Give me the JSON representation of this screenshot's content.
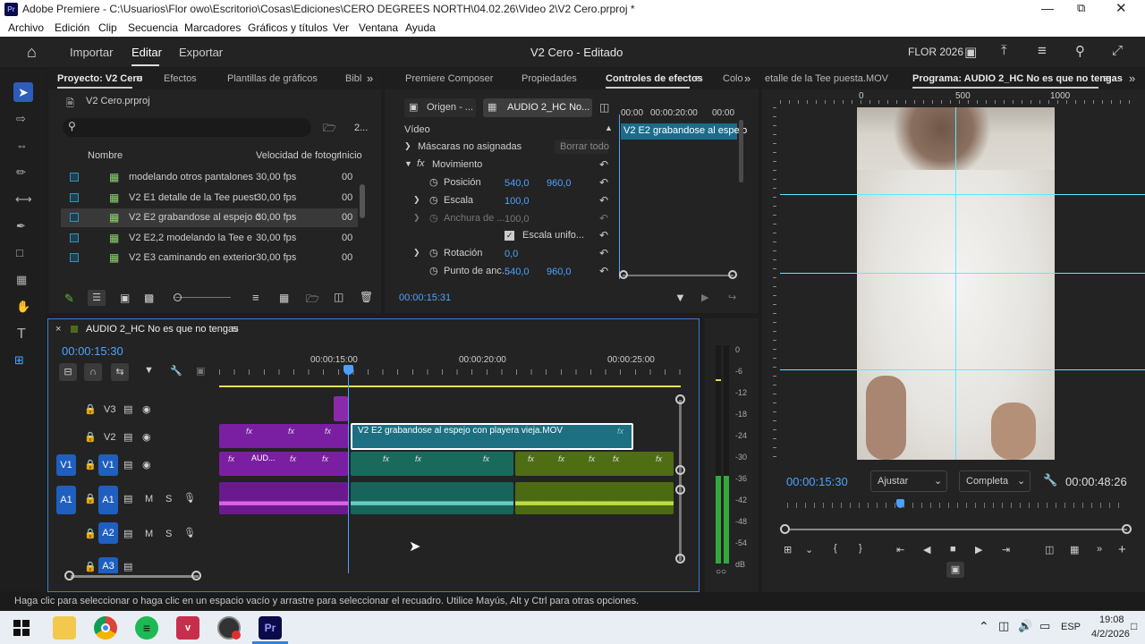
{
  "titlebar": {
    "title": "Adobe Premiere - C:\\Usuarios\\Flor owo\\Escritorio\\Cosas\\Ediciones\\CERO DEGREES NORTH\\04.02.26\\Video 2\\V2 Cero.prproj *",
    "app_icon": "Pr"
  },
  "menu": [
    "Archivo",
    "Edición",
    "Clip",
    "Secuencia",
    "Marcadores",
    "Gráficos y títulos",
    "Ver",
    "Ventana",
    "Ayuda"
  ],
  "topbar": {
    "import": "Importar",
    "edit": "Editar",
    "export": "Exportar",
    "doc_title": "V2 Cero - Editado",
    "workspace": "FLOR 2026"
  },
  "project": {
    "tabs": [
      "Proyecto: V2 Cero",
      "Efectos",
      "Plantillas de gráficos",
      "Bibl"
    ],
    "file": "V2 Cero.prproj",
    "count": "2...",
    "columns": {
      "name": "Nombre",
      "fps": "Velocidad de fotogr",
      "start": "Inicio"
    },
    "items": [
      {
        "name": "modelando otros pantalones",
        "fps": "30,00 fps",
        "start": "00"
      },
      {
        "name": "V2 E1 detalle de la Tee puest",
        "fps": "30,00 fps",
        "start": "00"
      },
      {
        "name": "V2 E2 grabandose al espejo c",
        "fps": "30,00 fps",
        "start": "00"
      },
      {
        "name": "V2 E2,2 modelando la Tee e",
        "fps": "30,00 fps",
        "start": "00"
      },
      {
        "name": "V2 E3 caminando en exterior",
        "fps": "30,00 fps",
        "start": "00"
      }
    ]
  },
  "effects": {
    "tabs": [
      "Premiere Composer",
      "Propiedades",
      "Controles de efectos",
      "Colo"
    ],
    "source_tab": "Origen - ...",
    "seq_tab": "AUDIO 2_HC No...",
    "video_label": "Vídeo",
    "masks": "Máscaras no asignadas",
    "clear_all": "Borrar todo",
    "motion": "Movimiento",
    "position": {
      "label": "Posición",
      "x": "540,0",
      "y": "960,0"
    },
    "scale": {
      "label": "Escala",
      "value": "100,0"
    },
    "width": {
      "label": "Anchura de ...",
      "value": "100,0"
    },
    "uniform": "Escala unifo...",
    "rotation": {
      "label": "Rotación",
      "value": "0,0"
    },
    "anchor": {
      "label": "Punto de anc...",
      "x": "540,0",
      "y": "960,0"
    },
    "mini_ruler": [
      "00:00",
      "00:00:20:00",
      "00:00"
    ],
    "clip_name": "V2 E2 grabandose al espejo",
    "timecode": "00:00:15:31"
  },
  "program": {
    "source_tab": "etalle de la Tee puesta.MOV",
    "title": "Programa: AUDIO 2_HC No es que no tengas",
    "ruler": [
      "0",
      "500",
      "1000"
    ],
    "timecode": "00:00:15:30",
    "fit": "Ajustar",
    "quality": "Completa",
    "duration": "00:00:48:26",
    "playhead_fraction": 0.32
  },
  "timeline": {
    "seq_name": "AUDIO 2_HC No es que no tengas",
    "timecode": "00:00:15:30",
    "ruler": [
      "00:00:15:00",
      "00:00:20:00",
      "00:00:25:00"
    ],
    "tracks": {
      "v3": "V3",
      "v2": "V2",
      "v1": "V1",
      "v1src": "V1",
      "a1": "A1",
      "a1src": "A1",
      "a2": "A2",
      "a3": "A3",
      "m": "M",
      "s": "S"
    },
    "clip_title": "V2 E2 grabandose al espejo con playera vieja.MOV",
    "aud_label": "AUD..."
  },
  "meter": {
    "scale": [
      "0",
      "-6",
      "-12",
      "-18",
      "-24",
      "-30",
      "-36",
      "-42",
      "-48",
      "-54",
      "dB"
    ]
  },
  "status": "Haga clic para seleccionar o haga clic en un espacio vacío y arrastre para seleccionar el recuadro. Utilice Mayús, Alt y Ctrl para otras opciones.",
  "tray": {
    "lang": "ESP",
    "time": "19:08",
    "date": "4/2/2026"
  },
  "colors": {
    "accent": "#2d8ceb",
    "v2clip": "#1d6f82",
    "purple": "#7a1fa2",
    "olive": "#5a7a16"
  }
}
